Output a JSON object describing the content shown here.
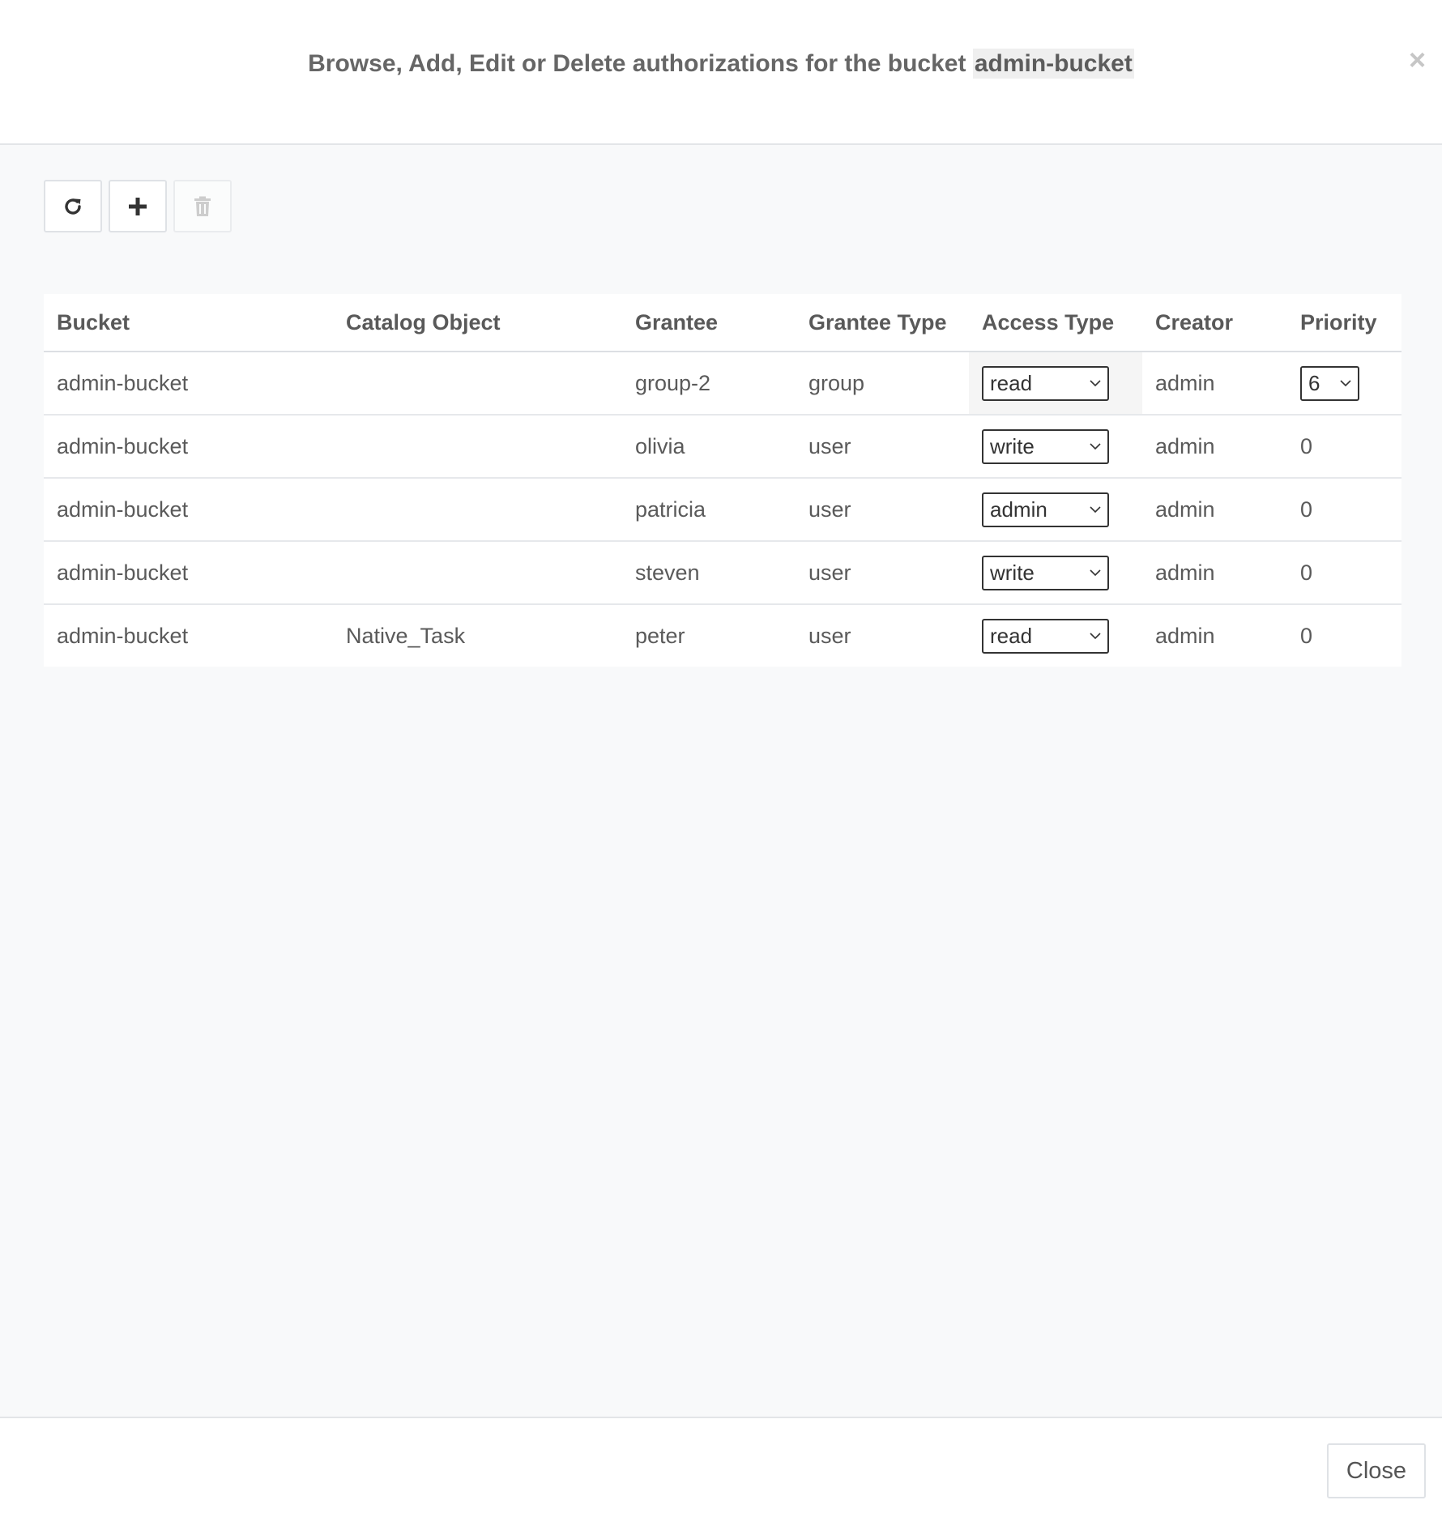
{
  "dialog": {
    "title_prefix": "Browse, Add, Edit or Delete authorizations for the bucket",
    "bucket_name": "admin-bucket",
    "close_symbol": "×"
  },
  "toolbar": {
    "refresh_icon": "refresh-icon",
    "add_icon": "plus-icon",
    "delete_icon": "trash-icon"
  },
  "table": {
    "columns": [
      "Bucket",
      "Catalog Object",
      "Grantee",
      "Grantee Type",
      "Access Type",
      "Creator",
      "Priority"
    ],
    "rows": [
      {
        "bucket": "admin-bucket",
        "catalog_object": "",
        "grantee": "group-2",
        "grantee_type": "group",
        "access_type": "read",
        "creator": "admin",
        "priority": "6"
      },
      {
        "bucket": "admin-bucket",
        "catalog_object": "",
        "grantee": "olivia",
        "grantee_type": "user",
        "access_type": "write",
        "creator": "admin",
        "priority": "0"
      },
      {
        "bucket": "admin-bucket",
        "catalog_object": "",
        "grantee": "patricia",
        "grantee_type": "user",
        "access_type": "admin",
        "creator": "admin",
        "priority": "0"
      },
      {
        "bucket": "admin-bucket",
        "catalog_object": "",
        "grantee": "steven",
        "grantee_type": "user",
        "access_type": "write",
        "creator": "admin",
        "priority": "0"
      },
      {
        "bucket": "admin-bucket",
        "catalog_object": "Native_Task",
        "grantee": "peter",
        "grantee_type": "user",
        "access_type": "read",
        "creator": "admin",
        "priority": "0"
      }
    ]
  },
  "footer": {
    "close_label": "Close"
  }
}
